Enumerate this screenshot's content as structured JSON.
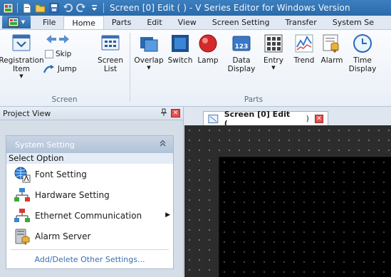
{
  "window": {
    "title": "Screen [0] Edit (            ) - V Series Editor for Windows Version"
  },
  "menu": {
    "tabs": [
      "File",
      "Home",
      "Parts",
      "Edit",
      "View",
      "Screen Setting",
      "Transfer",
      "System Se"
    ],
    "active": "Home"
  },
  "ribbon": {
    "screen_group": {
      "label": "Screen",
      "registration_item": "Registration\nItem",
      "skip": "Skip",
      "jump": "Jump",
      "screen_list": "Screen\nList"
    },
    "parts_group": {
      "label": "Parts",
      "overlap": "Overlap",
      "switch": "Switch",
      "lamp": "Lamp",
      "data_display": "Data\nDisplay",
      "data_display_icon_text": "123",
      "entry": "Entry",
      "trend": "Trend",
      "alarm": "Alarm",
      "time_display": "Time\nDisplay"
    }
  },
  "project_view": {
    "title": "Project View",
    "pin_glyph": "ᵖ",
    "system_setting_header": "System Setting",
    "select_option": "Select Option",
    "items": [
      {
        "label": "Font Setting",
        "icon": "font-setting-icon"
      },
      {
        "label": "Hardware Setting",
        "icon": "hardware-setting-icon"
      },
      {
        "label": "Ethernet Communication",
        "icon": "ethernet-icon",
        "has_submenu": true
      },
      {
        "label": "Alarm Server",
        "icon": "alarm-server-icon"
      }
    ],
    "add_delete_link": "Add/Delete Other Settings..."
  },
  "editor": {
    "doc_tab_label": "Screen [0] Edit (",
    "doc_tab_suffix": ")"
  },
  "colors": {
    "title_bar": "#2a6aa9",
    "canvas": "#000000",
    "link": "#3a6fb0"
  }
}
